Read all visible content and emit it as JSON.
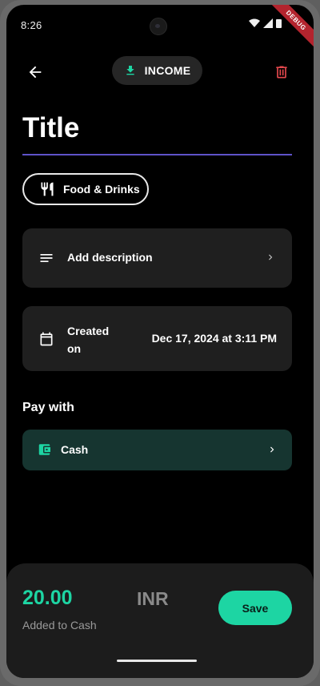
{
  "status_bar": {
    "time": "8:26",
    "debug_label": "DEBUG"
  },
  "header": {
    "type_label": "INCOME"
  },
  "title_input": {
    "value": "Title"
  },
  "category": {
    "label": "Food & Drinks"
  },
  "description": {
    "label": "Add description"
  },
  "created": {
    "label": "Created on",
    "value": "Dec 17, 2024 at 3:11 PM"
  },
  "payment": {
    "heading": "Pay with",
    "method": "Cash"
  },
  "summary": {
    "amount": "20.00",
    "currency": "INR",
    "added_to": "Added to Cash",
    "save_label": "Save"
  },
  "colors": {
    "accent": "#1dd5a3",
    "underline": "#5e52c8",
    "danger": "#e5484d",
    "pay_card_bg": "#163530"
  }
}
